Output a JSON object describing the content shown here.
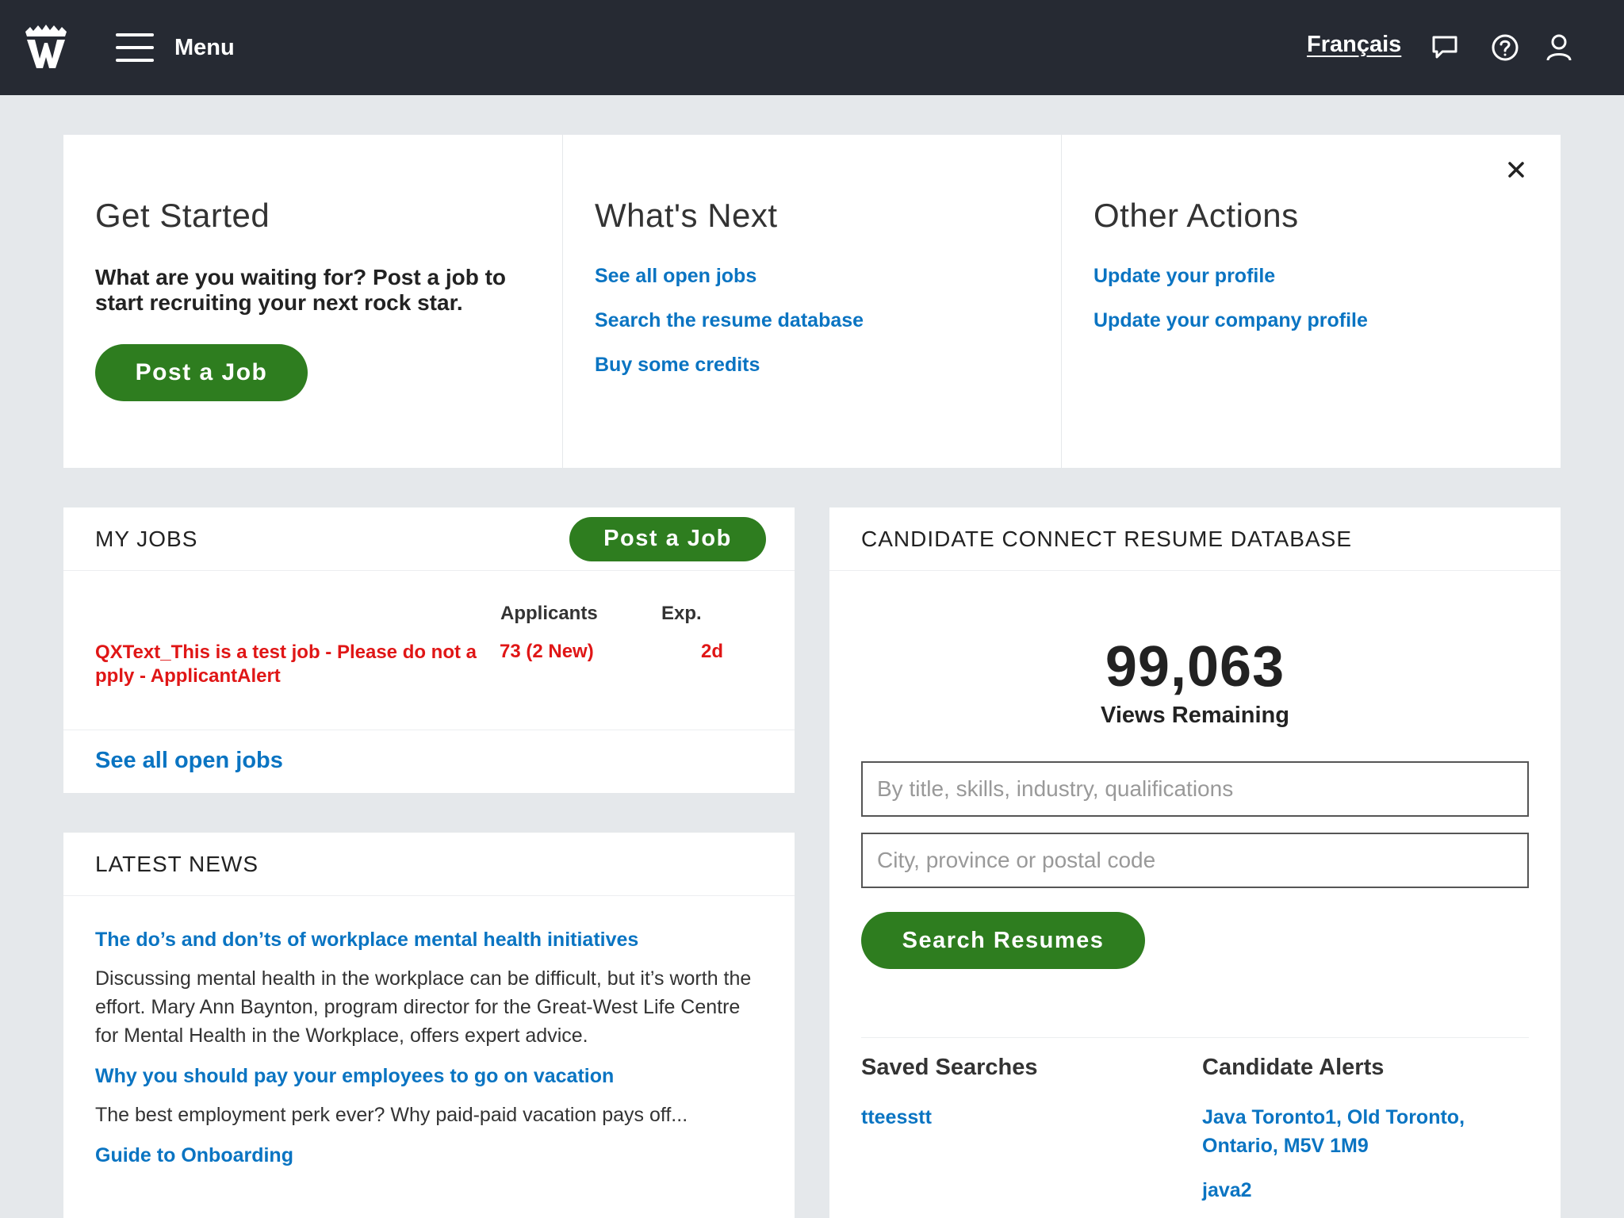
{
  "header": {
    "menu_label": "Menu",
    "lang_label": "Français",
    "icons": [
      "logo-icon",
      "hamburger-icon",
      "chat-icon",
      "help-icon",
      "user-icon"
    ]
  },
  "get_started": {
    "col1": {
      "title": "Get Started",
      "text": "What are you waiting for? Post a job to start recruiting your next rock star.",
      "button": "Post a Job"
    },
    "col2": {
      "title": "What's Next",
      "links": [
        "See all open jobs",
        "Search the resume database",
        "Buy some credits"
      ]
    },
    "col3": {
      "title": "Other Actions",
      "links": [
        "Update your profile",
        "Update your company profile"
      ]
    }
  },
  "my_jobs": {
    "title": "MY JOBS",
    "button": "Post a Job",
    "col_applicants": "Applicants",
    "col_exp": "Exp.",
    "job": {
      "title": "QXText_This is a test job - Please do not apply - ApplicantAlert",
      "applicants": "73 (2 New)",
      "exp": "2d"
    },
    "footer_link": "See all open jobs"
  },
  "news": {
    "title": "LATEST NEWS",
    "items": [
      {
        "title": "The do’s and don’ts of workplace mental health initiatives",
        "text": "Discussing mental health in the workplace can be difficult, but it’s worth the effort. Mary Ann Baynton, program director for the Great-West Life Centre for Mental Health in the Workplace, offers expert advice."
      },
      {
        "title": "Why you should pay your employees to go on vacation",
        "text": "The best employment perk ever? Why paid-paid vacation pays off..."
      },
      {
        "title": "Guide to Onboarding",
        "text": ""
      }
    ]
  },
  "candidate_connect": {
    "title": "CANDIDATE CONNECT RESUME DATABASE",
    "count": "99,063",
    "count_label": "Views Remaining",
    "keyword_placeholder": "By title, skills, industry, qualifications",
    "location_placeholder": "City, province or postal code",
    "button": "Search Resumes",
    "saved_title": "Saved Searches",
    "saved": [
      "tteesstt"
    ],
    "alerts_title": "Candidate Alerts",
    "alerts": [
      "Java Toronto1, Old Toronto, Ontario, M5V 1M9",
      "java2"
    ]
  },
  "colors": {
    "topbar": "#262a33",
    "accent_green": "#2e7d1f",
    "link_blue": "#0a74c2",
    "alert_red": "#e01616",
    "page_bg": "#e5e8eb"
  }
}
